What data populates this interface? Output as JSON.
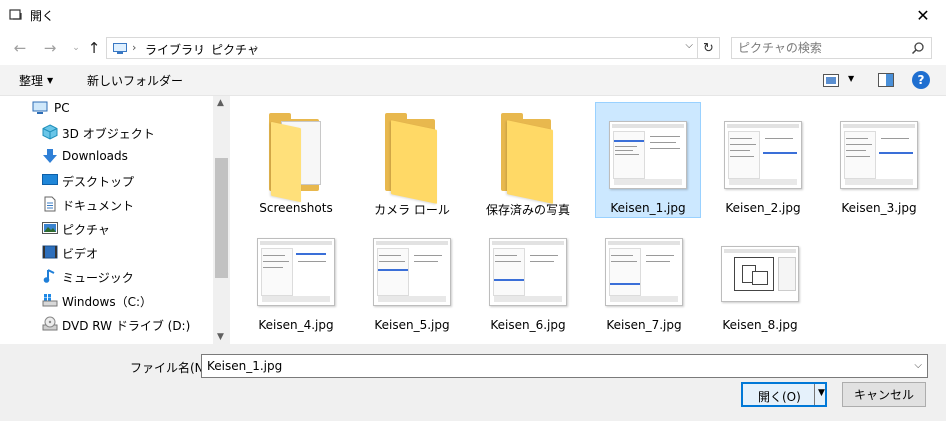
{
  "window": {
    "title": "開く",
    "close_glyph": "✕"
  },
  "address": {
    "crumbs": [
      "ライブラリ",
      "ピクチャ"
    ],
    "search_placeholder": "ピクチャの検索"
  },
  "toolbar": {
    "organize": "整理",
    "new_folder": "新しいフォルダー",
    "help": "?"
  },
  "sidebar": {
    "items": [
      {
        "label": "PC",
        "icon": "pc-icon"
      },
      {
        "label": "3D オブジェクト",
        "icon": "3d-objects-icon"
      },
      {
        "label": "Downloads",
        "icon": "download-icon"
      },
      {
        "label": "デスクトップ",
        "icon": "desktop-icon"
      },
      {
        "label": "ドキュメント",
        "icon": "document-icon"
      },
      {
        "label": "ピクチャ",
        "icon": "pictures-icon"
      },
      {
        "label": "ビデオ",
        "icon": "video-icon"
      },
      {
        "label": "ミュージック",
        "icon": "music-icon"
      },
      {
        "label": "Windows（C:）",
        "icon": "drive-icon"
      },
      {
        "label": "DVD RW ドライブ (D:)",
        "icon": "dvd-icon"
      }
    ]
  },
  "files": [
    {
      "name": "Screenshots",
      "kind": "folder",
      "selected": false
    },
    {
      "name": "カメラ ロール",
      "kind": "folder",
      "selected": false
    },
    {
      "name": "保存済みの写真",
      "kind": "folder",
      "selected": false
    },
    {
      "name": "Keisen_1.jpg",
      "kind": "image",
      "selected": true
    },
    {
      "name": "Keisen_2.jpg",
      "kind": "image",
      "selected": false
    },
    {
      "name": "Keisen_3.jpg",
      "kind": "image",
      "selected": false
    },
    {
      "name": "Keisen_4.jpg",
      "kind": "image",
      "selected": false
    },
    {
      "name": "Keisen_5.jpg",
      "kind": "image",
      "selected": false
    },
    {
      "name": "Keisen_6.jpg",
      "kind": "image",
      "selected": false
    },
    {
      "name": "Keisen_7.jpg",
      "kind": "image",
      "selected": false
    },
    {
      "name": "Keisen_8.jpg",
      "kind": "image",
      "selected": false
    }
  ],
  "bottom": {
    "filename_label": "ファイル名(N):",
    "filename_value": "Keisen_1.jpg",
    "open_label": "開く(O)",
    "cancel_label": "キャンセル"
  },
  "colors": {
    "accent": "#0078d7",
    "selection": "#cce8ff",
    "folder": "#ffd966"
  }
}
